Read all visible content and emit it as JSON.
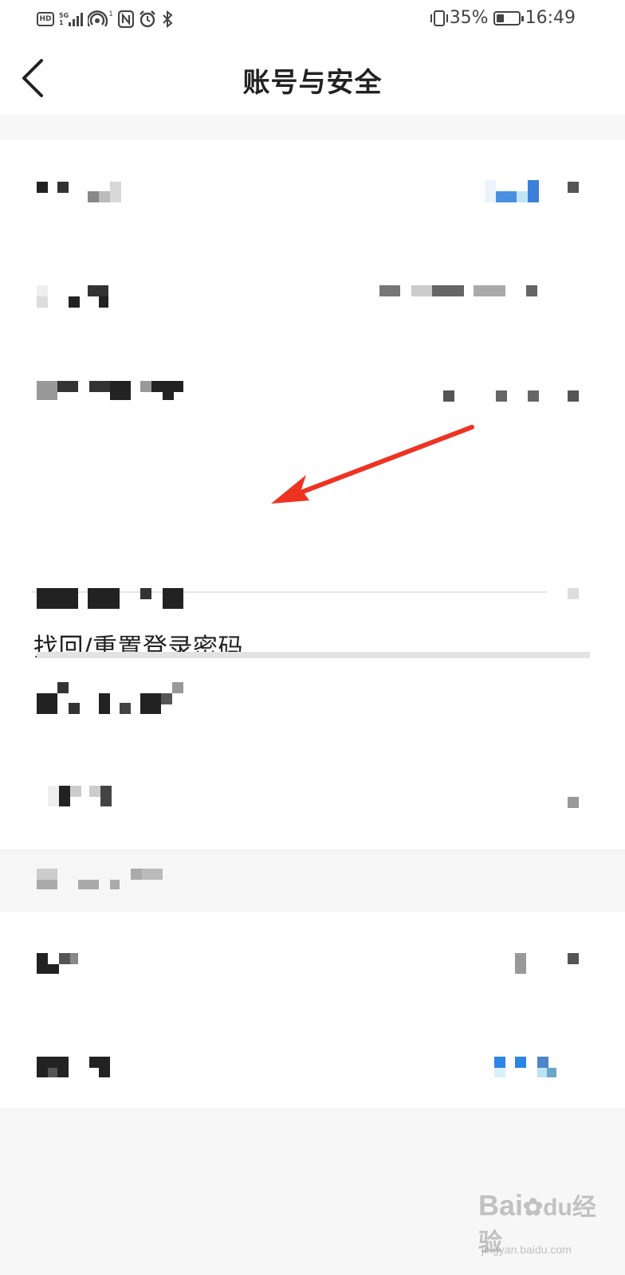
{
  "status_bar": {
    "left_icons": [
      "hd-icon",
      "5g-signal-icon",
      "hotspot-icon",
      "nfc-icon",
      "alarm-icon",
      "bluetooth-icon"
    ],
    "hd_label": "HD",
    "signal_label_top": "5G",
    "signal_label_bottom": "1",
    "hotspot_superscript": "1",
    "battery_percent_text": "35%",
    "battery_level": 0.35,
    "time": "16:49"
  },
  "header": {
    "title": "账号与安全",
    "back_icon": "chevron-left-icon"
  },
  "reset_password_row": {
    "label": "找回/重置登录密码"
  },
  "annotation": {
    "arrow_color": "#ee3322"
  },
  "watermark": {
    "brand": "Bai",
    "brand_suffix": "经验",
    "url": "jingyan.baidu.com"
  },
  "colors": {
    "accent_blue": "#2b84e6",
    "background": "#f7f7f8",
    "text_primary": "#222222"
  }
}
